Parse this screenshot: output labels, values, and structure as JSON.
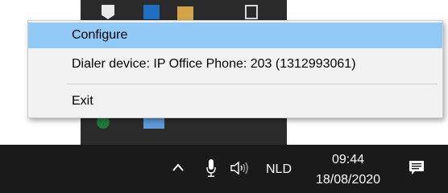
{
  "context_menu": {
    "configure": "Configure",
    "dialer_device": "Dialer device: IP Office Phone: 203 (1312993061)",
    "exit": "Exit"
  },
  "taskbar": {
    "language": "NLD",
    "time": "09:44",
    "date": "18/08/2020"
  },
  "icons": {
    "chevron": "chevron-up-icon",
    "mic": "microphone-icon",
    "volume": "volume-icon",
    "notifications": "notification-center-icon"
  },
  "colors": {
    "menu_highlight": "#91c9f7",
    "taskbar_bg": "#1a1a1a"
  }
}
